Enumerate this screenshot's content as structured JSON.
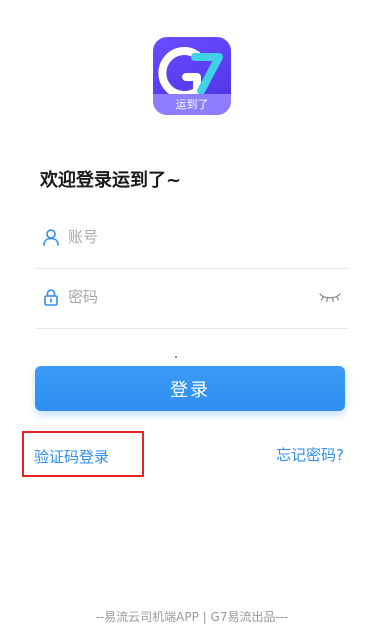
{
  "logo": {
    "caption": "运到了",
    "icon": "g7-logo-icon"
  },
  "welcome_text": "欢迎登录运到了~",
  "account_field": {
    "placeholder": "账号",
    "value": "",
    "icon": "user-icon"
  },
  "password_field": {
    "placeholder": "密码",
    "value": "",
    "icon": "lock-icon",
    "toggle_icon": "eye-closed-icon"
  },
  "login_button": {
    "label": "登录"
  },
  "links": {
    "sms_login": "验证码登录",
    "forgot_password": "忘记密码?"
  },
  "footer_text": "--易流云司机端APP | G7易流出品---",
  "colors": {
    "brand_purple": "#5a3df0",
    "accent_blue": "#2f8ef0",
    "highlight_red": "#e62323"
  }
}
